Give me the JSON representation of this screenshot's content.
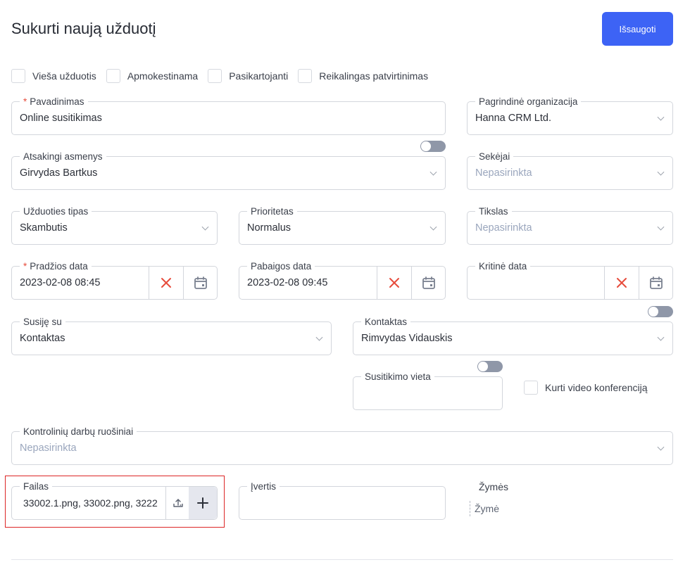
{
  "page": {
    "title": "Sukurti naują užduotį",
    "save_label": "Išsaugoti"
  },
  "checkboxes": [
    {
      "label": "Vieša užduotis",
      "checked": false
    },
    {
      "label": "Apmokestinama",
      "checked": false
    },
    {
      "label": "Pasikartojanti",
      "checked": false
    },
    {
      "label": "Reikalingas patvirtinimas",
      "checked": false
    }
  ],
  "fields": {
    "pavadinimas": {
      "label": "Pavadinimas",
      "required": "*",
      "value": "Online susitikimas"
    },
    "organizacija": {
      "label": "Pagrindinė organizacija",
      "value": "Hanna CRM Ltd."
    },
    "atsakingi": {
      "label": "Atsakingi asmenys",
      "value": "Girvydas Bartkus"
    },
    "sekejai": {
      "label": "Sekėjai",
      "placeholder": "Nepasirinkta"
    },
    "tipas": {
      "label": "Užduoties tipas",
      "value": "Skambutis"
    },
    "prioritetas": {
      "label": "Prioritetas",
      "value": "Normalus"
    },
    "tikslas": {
      "label": "Tikslas",
      "placeholder": "Nepasirinkta"
    },
    "pradzia": {
      "label": "Pradžios data",
      "required": "*",
      "value": "2023-02-08 08:45"
    },
    "pabaiga": {
      "label": "Pabaigos data",
      "value": "2023-02-08 09:45"
    },
    "kritine": {
      "label": "Kritinė data",
      "value": ""
    },
    "susije": {
      "label": "Susiję su",
      "value": "Kontaktas"
    },
    "kontaktas": {
      "label": "Kontaktas",
      "value": "Rimvydas Vidauskis"
    },
    "vieta": {
      "label": "Susitikimo vieta",
      "value": ""
    },
    "video": {
      "label": "Kurti video konferenciją",
      "checked": false
    },
    "kontroliniai": {
      "label": "Kontrolinių darbų ruošiniai",
      "placeholder": "Nepasirinkta"
    },
    "failas": {
      "label": "Failas",
      "value": "33002.1.png, 33002.png, 3222"
    },
    "ivertis": {
      "label": "Įvertis",
      "value": ""
    },
    "zymes": {
      "label": "Žymės",
      "placeholder": "Žymė"
    }
  },
  "colors": {
    "accent": "#3d63f5",
    "clear": "#e74c3c",
    "highlight": "#dc2626"
  }
}
